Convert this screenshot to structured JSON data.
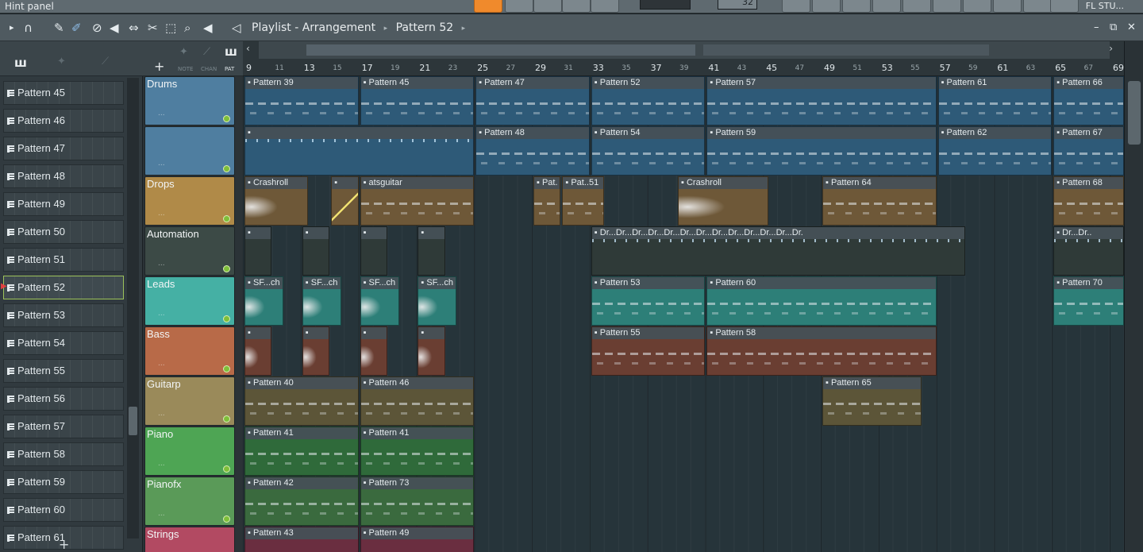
{
  "hint_panel": {
    "label": "Hint panel"
  },
  "top_toolbar": {
    "brand_label": "FL STU...",
    "tempo_value": "32"
  },
  "playlist_window": {
    "title": "Playlist - Arrangement",
    "separator": "▸",
    "current_pattern": "Pattern 52"
  },
  "toolbar_icons": [
    "arrow-right-icon",
    "magnet-icon",
    "pencil-icon",
    "paint-icon",
    "delete-icon",
    "mute-icon",
    "slip-icon",
    "slice-icon",
    "select-icon",
    "zoom-icon",
    "playback-icon",
    "speaker-icon"
  ],
  "header_modes": {
    "note": "NOTE",
    "chan": "CHAN",
    "pat": "PAT",
    "add": "+"
  },
  "browser": {
    "add_label": "+",
    "items": [
      "Pattern 45",
      "Pattern 46",
      "Pattern 47",
      "Pattern 48",
      "Pattern 49",
      "Pattern 50",
      "Pattern 51",
      "Pattern 52",
      "Pattern 53",
      "Pattern 54",
      "Pattern 55",
      "Pattern 56",
      "Pattern 57",
      "Pattern 58",
      "Pattern 59",
      "Pattern 60",
      "Pattern 61"
    ],
    "selected": "Pattern 52"
  },
  "ruler": {
    "bars": [
      "9",
      "11",
      "13",
      "15",
      "17",
      "19",
      "21",
      "23",
      "25",
      "27",
      "29",
      "31",
      "33",
      "35",
      "37",
      "39",
      "41",
      "43",
      "45",
      "47",
      "49",
      "51",
      "53",
      "55",
      "57",
      "59",
      "61",
      "63",
      "65",
      "67",
      "69"
    ]
  },
  "tracks": [
    {
      "name": "Drums",
      "color": "#4f7ea0",
      "dots": "..."
    },
    {
      "name": "",
      "color": "#4f7ea0",
      "dots": "..."
    },
    {
      "name": "Drops",
      "color": "#b08a48",
      "dots": "..."
    },
    {
      "name": "Automation",
      "color": "#3c4a46",
      "dots": "..."
    },
    {
      "name": "Leads",
      "color": "#45b0a4",
      "dots": "..."
    },
    {
      "name": "Bass",
      "color": "#b86a48",
      "dots": "..."
    },
    {
      "name": "Guitarp",
      "color": "#9a8a5a",
      "dots": "..."
    },
    {
      "name": "Piano",
      "color": "#4ea554",
      "dots": "..."
    },
    {
      "name": "Pianofx",
      "color": "#5a9a58",
      "dots": "..."
    },
    {
      "name": "Strings",
      "color": "#b24a62",
      "dots": "..."
    }
  ],
  "clips": [
    {
      "row": 0,
      "label": "Pattern 39",
      "start": 0,
      "len": 2,
      "kind": "notes",
      "color": "#2e5a78"
    },
    {
      "row": 0,
      "label": "Pattern 45",
      "start": 2,
      "len": 2,
      "kind": "notes",
      "color": "#2e5a78"
    },
    {
      "row": 0,
      "label": "Pattern 47",
      "start": 4,
      "len": 2,
      "kind": "notes",
      "color": "#2e5a78"
    },
    {
      "row": 0,
      "label": "Pattern 52",
      "start": 6,
      "len": 2,
      "kind": "notes",
      "color": "#2e5a78"
    },
    {
      "row": 0,
      "label": "Pattern 57",
      "start": 8,
      "len": 4,
      "kind": "notes",
      "color": "#2e5a78"
    },
    {
      "row": 0,
      "label": "Pattern 61",
      "start": 12,
      "len": 2,
      "kind": "notes",
      "color": "#2e5a78"
    },
    {
      "row": 0,
      "label": "Pattern 66",
      "start": 14,
      "len": 1.25,
      "kind": "notes",
      "color": "#2e5a78"
    },
    {
      "row": 1,
      "label": "",
      "start": 0,
      "len": 4,
      "kind": "steps",
      "color": "#2e5a78"
    },
    {
      "row": 1,
      "label": "Pattern 48",
      "start": 4,
      "len": 2,
      "kind": "notes",
      "color": "#2e5a78"
    },
    {
      "row": 1,
      "label": "Pattern 54",
      "start": 6,
      "len": 2,
      "kind": "notes",
      "color": "#2e5a78"
    },
    {
      "row": 1,
      "label": "Pattern 59",
      "start": 8,
      "len": 4,
      "kind": "notes",
      "color": "#2e5a78"
    },
    {
      "row": 1,
      "label": "Pattern 62",
      "start": 12,
      "len": 2,
      "kind": "notes",
      "color": "#2e5a78"
    },
    {
      "row": 1,
      "label": "Pattern 67",
      "start": 14,
      "len": 1.25,
      "kind": "notes",
      "color": "#2e5a78"
    },
    {
      "row": 2,
      "label": "Crashroll",
      "start": 0,
      "len": 1.12,
      "kind": "wave",
      "color": "#6e5838"
    },
    {
      "row": 2,
      "label": "",
      "start": 1.5,
      "len": 0.5,
      "kind": "auto",
      "color": "#6e5838"
    },
    {
      "row": 2,
      "label": "atsguitar",
      "start": 2,
      "len": 2,
      "kind": "notes",
      "color": "#6e5838"
    },
    {
      "row": 2,
      "label": "Pat.",
      "start": 5,
      "len": 0.5,
      "kind": "notes",
      "color": "#6e5838"
    },
    {
      "row": 2,
      "label": "Pat..51",
      "start": 5.5,
      "len": 0.75,
      "kind": "notes",
      "color": "#6e5838"
    },
    {
      "row": 2,
      "label": "Crashroll",
      "start": 7.5,
      "len": 1.6,
      "kind": "wave",
      "color": "#6e5838"
    },
    {
      "row": 2,
      "label": "Pattern 64",
      "start": 10,
      "len": 2,
      "kind": "notes",
      "color": "#6e5838"
    },
    {
      "row": 2,
      "label": "Pattern 68",
      "start": 14,
      "len": 1.25,
      "kind": "notes",
      "color": "#6e5838"
    },
    {
      "row": 3,
      "label": "",
      "start": 0,
      "len": 0.5,
      "kind": "blank",
      "color": "#2f3a38"
    },
    {
      "row": 3,
      "label": "",
      "start": 1,
      "len": 0.5,
      "kind": "blank",
      "color": "#2f3a38"
    },
    {
      "row": 3,
      "label": "",
      "start": 2,
      "len": 0.5,
      "kind": "blank",
      "color": "#2f3a38"
    },
    {
      "row": 3,
      "label": "",
      "start": 3,
      "len": 0.5,
      "kind": "blank",
      "color": "#2f3a38"
    },
    {
      "row": 3,
      "label": "Dr...Dr...Dr...Dr...Dr...Dr...Dr...Dr...Dr...Dr...Dr...Dr...Dr.",
      "start": 6,
      "len": 6.5,
      "kind": "steps",
      "color": "#2f3a38"
    },
    {
      "row": 3,
      "label": "Dr...Dr..",
      "start": 14,
      "len": 1.25,
      "kind": "steps",
      "color": "#2f3a38"
    },
    {
      "row": 4,
      "label": "SF...ch",
      "start": 0,
      "len": 0.7,
      "kind": "wave",
      "color": "#2d7f78"
    },
    {
      "row": 4,
      "label": "SF...ch",
      "start": 1,
      "len": 0.7,
      "kind": "wave",
      "color": "#2d7f78"
    },
    {
      "row": 4,
      "label": "SF...ch",
      "start": 2,
      "len": 0.7,
      "kind": "wave",
      "color": "#2d7f78"
    },
    {
      "row": 4,
      "label": "SF...ch",
      "start": 3,
      "len": 0.7,
      "kind": "wave",
      "color": "#2d7f78"
    },
    {
      "row": 4,
      "label": "Pattern 53",
      "start": 6,
      "len": 2,
      "kind": "notes",
      "color": "#2d7f78"
    },
    {
      "row": 4,
      "label": "Pattern 60",
      "start": 8,
      "len": 4,
      "kind": "notes",
      "color": "#2d7f78"
    },
    {
      "row": 4,
      "label": "Pattern 70",
      "start": 14,
      "len": 1.25,
      "kind": "notes",
      "color": "#2d7f78"
    },
    {
      "row": 5,
      "label": "",
      "start": 0,
      "len": 0.5,
      "kind": "wave",
      "color": "#6a3e32"
    },
    {
      "row": 5,
      "label": "",
      "start": 1,
      "len": 0.5,
      "kind": "wave",
      "color": "#6a3e32"
    },
    {
      "row": 5,
      "label": "",
      "start": 2,
      "len": 0.5,
      "kind": "wave",
      "color": "#6a3e32"
    },
    {
      "row": 5,
      "label": "",
      "start": 3,
      "len": 0.5,
      "kind": "wave",
      "color": "#6a3e32"
    },
    {
      "row": 5,
      "label": "Pattern 55",
      "start": 6,
      "len": 2,
      "kind": "notes",
      "color": "#6a3e32"
    },
    {
      "row": 5,
      "label": "Pattern 58",
      "start": 8,
      "len": 4,
      "kind": "notes",
      "color": "#6a3e32"
    },
    {
      "row": 6,
      "label": "Pattern 40",
      "start": 0,
      "len": 2,
      "kind": "notes",
      "color": "#5c5538"
    },
    {
      "row": 6,
      "label": "Pattern 46",
      "start": 2,
      "len": 2,
      "kind": "notes",
      "color": "#5c5538"
    },
    {
      "row": 6,
      "label": "Pattern 65",
      "start": 10,
      "len": 1.75,
      "kind": "notes",
      "color": "#5c5538"
    },
    {
      "row": 7,
      "label": "Pattern 41",
      "start": 0,
      "len": 2,
      "kind": "notes",
      "color": "#2f6a3a"
    },
    {
      "row": 7,
      "label": "Pattern 41",
      "start": 2,
      "len": 2,
      "kind": "notes",
      "color": "#2f6a3a"
    },
    {
      "row": 8,
      "label": "Pattern 42",
      "start": 0,
      "len": 2,
      "kind": "notes",
      "color": "#3a6a3e"
    },
    {
      "row": 8,
      "label": "Pattern 73",
      "start": 2,
      "len": 2,
      "kind": "notes",
      "color": "#3a6a3e"
    },
    {
      "row": 9,
      "label": "Pattern 43",
      "start": 0,
      "len": 2,
      "kind": "notes",
      "color": "#6a2e40"
    },
    {
      "row": 9,
      "label": "Pattern 49",
      "start": 2,
      "len": 2,
      "kind": "notes",
      "color": "#6a2e40"
    }
  ]
}
